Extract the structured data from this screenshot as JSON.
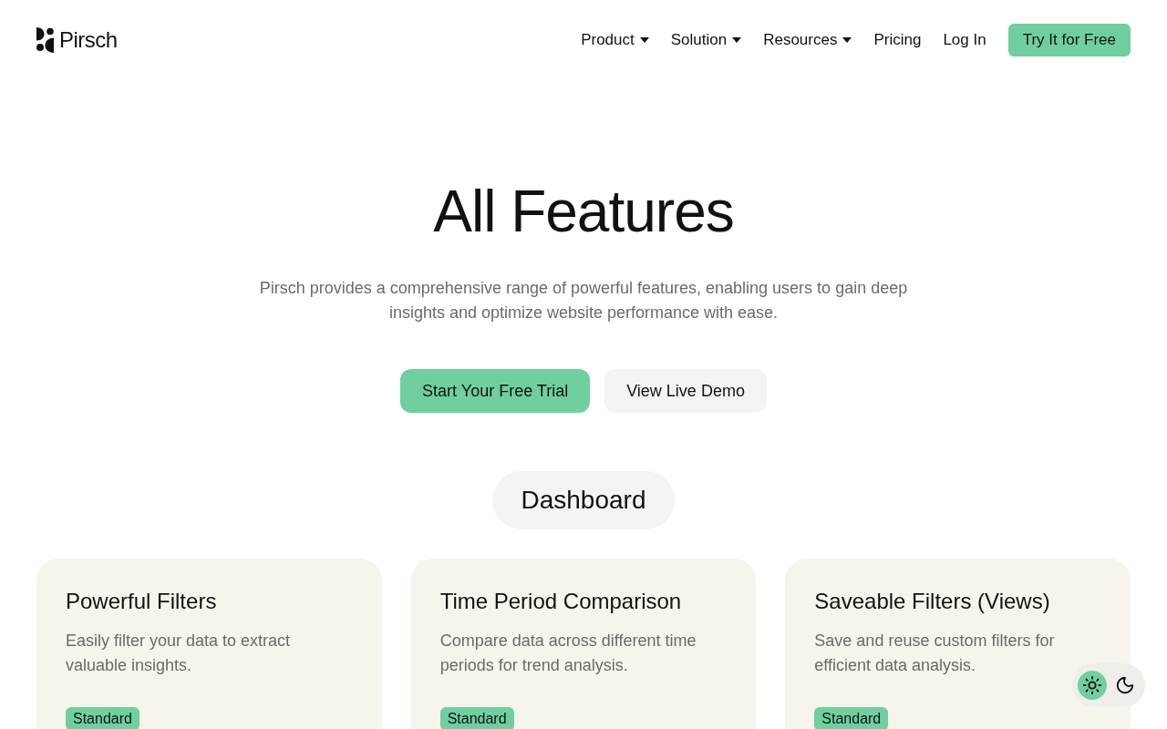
{
  "header": {
    "logo": {
      "name": "Pirsch"
    },
    "nav": [
      {
        "label": "Product",
        "dropdown": true
      },
      {
        "label": "Solution",
        "dropdown": true
      },
      {
        "label": "Resources",
        "dropdown": true
      },
      {
        "label": "Pricing",
        "dropdown": false
      },
      {
        "label": "Log In",
        "dropdown": false
      }
    ],
    "cta": "Try It for Free"
  },
  "hero": {
    "title": "All Features",
    "description": "Pirsch provides a comprehensive range of powerful features, enabling users to gain deep insights and optimize website performance with ease.",
    "buttons": [
      {
        "label": "Start Your Free Trial",
        "kind": "primary"
      },
      {
        "label": "View Live Demo",
        "kind": "secondary"
      }
    ]
  },
  "section": {
    "title": "Dashboard",
    "cards": [
      {
        "title": "Powerful Filters",
        "description": "Easily filter your data to extract valuable insights.",
        "badge": "Standard"
      },
      {
        "title": "Time Period Comparison",
        "description": "Compare data across different time periods for trend analysis.",
        "badge": "Standard"
      },
      {
        "title": "Saveable Filters (Views)",
        "description": "Save and reuse custom filters for efficient data analysis.",
        "badge": "Standard"
      }
    ]
  },
  "theme_toggle": {
    "options": [
      {
        "kind": "light",
        "selected": true
      },
      {
        "kind": "dark",
        "selected": false
      }
    ]
  }
}
